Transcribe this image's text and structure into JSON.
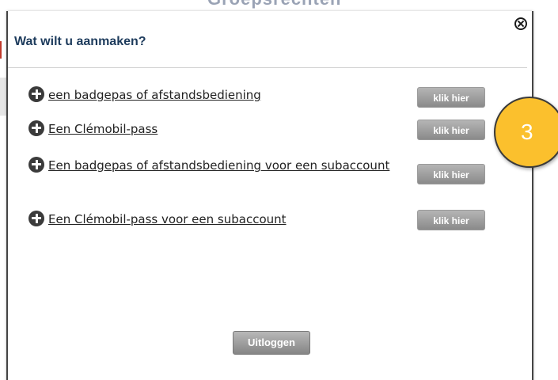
{
  "background": {
    "title": "Groepsrechten"
  },
  "dialog": {
    "title": "Wat wilt u aanmaken?",
    "close_icon": "circled-x-icon",
    "options": [
      {
        "label": "een badgepas of afstandsbediening",
        "button": "klik hier"
      },
      {
        "label": "Een Clémobil-pass",
        "button": "klik hier"
      },
      {
        "label": "Een badgepas of afstandsbediening voor een subaccount",
        "button": "klik hier"
      },
      {
        "label": "Een Clémobil-pass voor een subaccount",
        "button": "klik hier"
      }
    ],
    "logout_label": "Uitloggen"
  },
  "step_badge": {
    "number": "3",
    "color": "#fbc02d"
  },
  "colors": {
    "title": "#1d3b5c",
    "button": "#9a9a9a"
  }
}
